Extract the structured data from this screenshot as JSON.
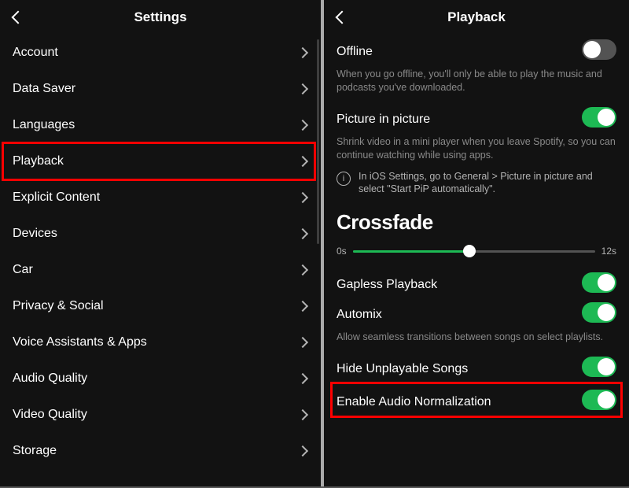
{
  "left": {
    "title": "Settings",
    "items": [
      {
        "label": "Account"
      },
      {
        "label": "Data Saver"
      },
      {
        "label": "Languages"
      },
      {
        "label": "Playback",
        "highlighted": true
      },
      {
        "label": "Explicit Content"
      },
      {
        "label": "Devices"
      },
      {
        "label": "Car"
      },
      {
        "label": "Privacy & Social"
      },
      {
        "label": "Voice Assistants & Apps"
      },
      {
        "label": "Audio Quality"
      },
      {
        "label": "Video Quality"
      },
      {
        "label": "Storage"
      }
    ]
  },
  "right": {
    "title": "Playback",
    "offline": {
      "label": "Offline",
      "enabled": false,
      "desc": "When you go offline, you'll only be able to play the music and podcasts you've downloaded."
    },
    "pip": {
      "label": "Picture in picture",
      "enabled": true,
      "desc": "Shrink video in a mini player when you leave Spotify, so you can continue watching while using apps.",
      "info": "In iOS Settings, go to General > Picture in picture and select \"Start PiP automatically\"."
    },
    "crossfade": {
      "heading": "Crossfade",
      "min_label": "0s",
      "max_label": "12s",
      "value": 6,
      "min": 0,
      "max": 12
    },
    "gapless": {
      "label": "Gapless Playback",
      "enabled": true
    },
    "automix": {
      "label": "Automix",
      "enabled": true,
      "desc": "Allow seamless transitions between songs on select playlists."
    },
    "hide_unplayable": {
      "label": "Hide Unplayable Songs",
      "enabled": true
    },
    "normalize": {
      "label": "Enable Audio Normalization",
      "enabled": true,
      "highlighted": true
    }
  }
}
